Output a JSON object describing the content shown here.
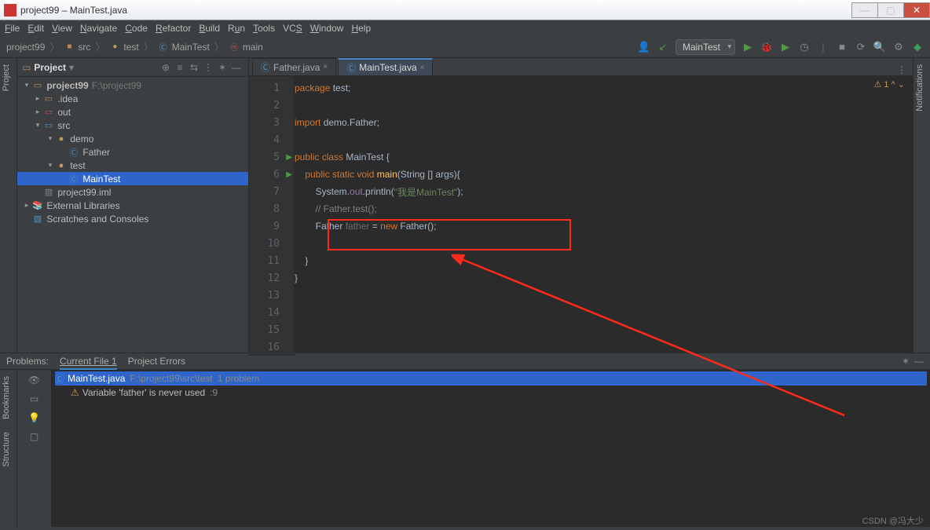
{
  "window": {
    "title": "project99 – MainTest.java"
  },
  "menu": [
    "File",
    "Edit",
    "View",
    "Navigate",
    "Code",
    "Refactor",
    "Build",
    "Run",
    "Tools",
    "VCS",
    "Window",
    "Help"
  ],
  "breadcrumb": [
    "project99",
    "src",
    "test",
    "MainTest",
    "main"
  ],
  "run_config": "MainTest",
  "project_panel": {
    "title": "Project"
  },
  "tree": {
    "root": {
      "name": "project99",
      "path": "F:\\project99"
    },
    "idea": ".idea",
    "out": "out",
    "src": "src",
    "demo": "demo",
    "father": "Father",
    "test": "test",
    "maintest": "MainTest",
    "iml": "project99.iml",
    "ext": "External Libraries",
    "scr": "Scratches and Consoles"
  },
  "tabs": [
    {
      "name": "Father.java",
      "active": false
    },
    {
      "name": "MainTest.java",
      "active": true
    }
  ],
  "inspection": "⚠ 1  ^  ⌄",
  "code": {
    "l1": "package test;",
    "l4": "import demo.Father;",
    "l6a": "public class",
    "l6b": " MainTest {",
    "l7a": "    public static void",
    "l7b": " main(String [] args){",
    "l8a": "        System.",
    "l8b": "out",
    "l8c": ".println(",
    "l8d": "\"我是MainTest\"",
    "l8e": ");",
    "l9": "        // Father.test();",
    "l10a": "        Father ",
    "l10b": "father",
    "l10c": " = ",
    "l10d": "new",
    "l10e": " Father();",
    "l12": "    }",
    "l13": "}"
  },
  "problems": {
    "tabs": [
      "Problems:",
      "Current File 1",
      "Project Errors"
    ],
    "file": {
      "name": "MainTest.java",
      "path": "F:\\project99\\src\\test",
      "count": "1 problem"
    },
    "warn": {
      "msg": "Variable 'father' is never used",
      "line": ":9"
    }
  },
  "side_left": [
    "Project"
  ],
  "side_right": [
    "Notifications"
  ],
  "side_bottom": [
    "Bookmarks",
    "Structure"
  ],
  "watermark": "CSDN @冯大少"
}
